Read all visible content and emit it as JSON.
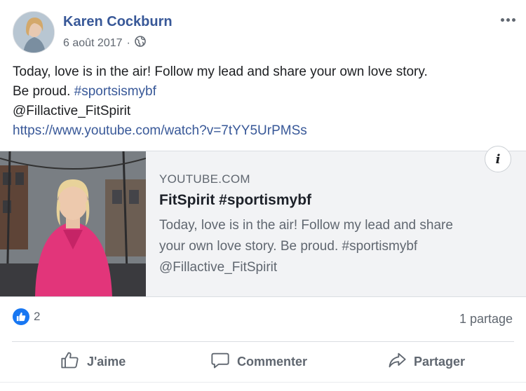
{
  "post": {
    "author": "Karen Cockburn",
    "date": "6 août 2017",
    "separator": "·",
    "text_line1": "Today, love is in the air! Follow my lead and share your own love story.",
    "text_line2_prefix": "Be proud. ",
    "hashtag": "#sportsismybf",
    "mention": "@Fillactive_FitSpirit",
    "url": "https://www.youtube.com/watch?v=7tYY5UrPMSs"
  },
  "link_preview": {
    "domain": "YOUTUBE.COM",
    "title": "FitSpirit #sportismybf",
    "desc_line1": "Today, love is in the air! Follow my lead and share",
    "desc_line2": "your own love story. Be proud. #sportismybf",
    "desc_line3": "@Fillactive_FitSpirit",
    "info_label": "i"
  },
  "stats": {
    "reaction_count": "2",
    "shares": "1 partage"
  },
  "actions": {
    "like": "J'aime",
    "comment": "Commenter",
    "share": "Partager"
  },
  "icons": {
    "privacy": "globe-icon",
    "like_reaction": "thumbs-up-icon",
    "more": "more-options-icon",
    "like_action": "thumbs-up-outline-icon",
    "comment_action": "speech-bubble-icon",
    "share_action": "share-arrow-icon"
  },
  "colors": {
    "link": "#385898",
    "like_blue": "#1877f2",
    "secondary_text": "#606770",
    "preview_bg": "#f2f3f5",
    "shirt_pink": "#e2357a"
  }
}
